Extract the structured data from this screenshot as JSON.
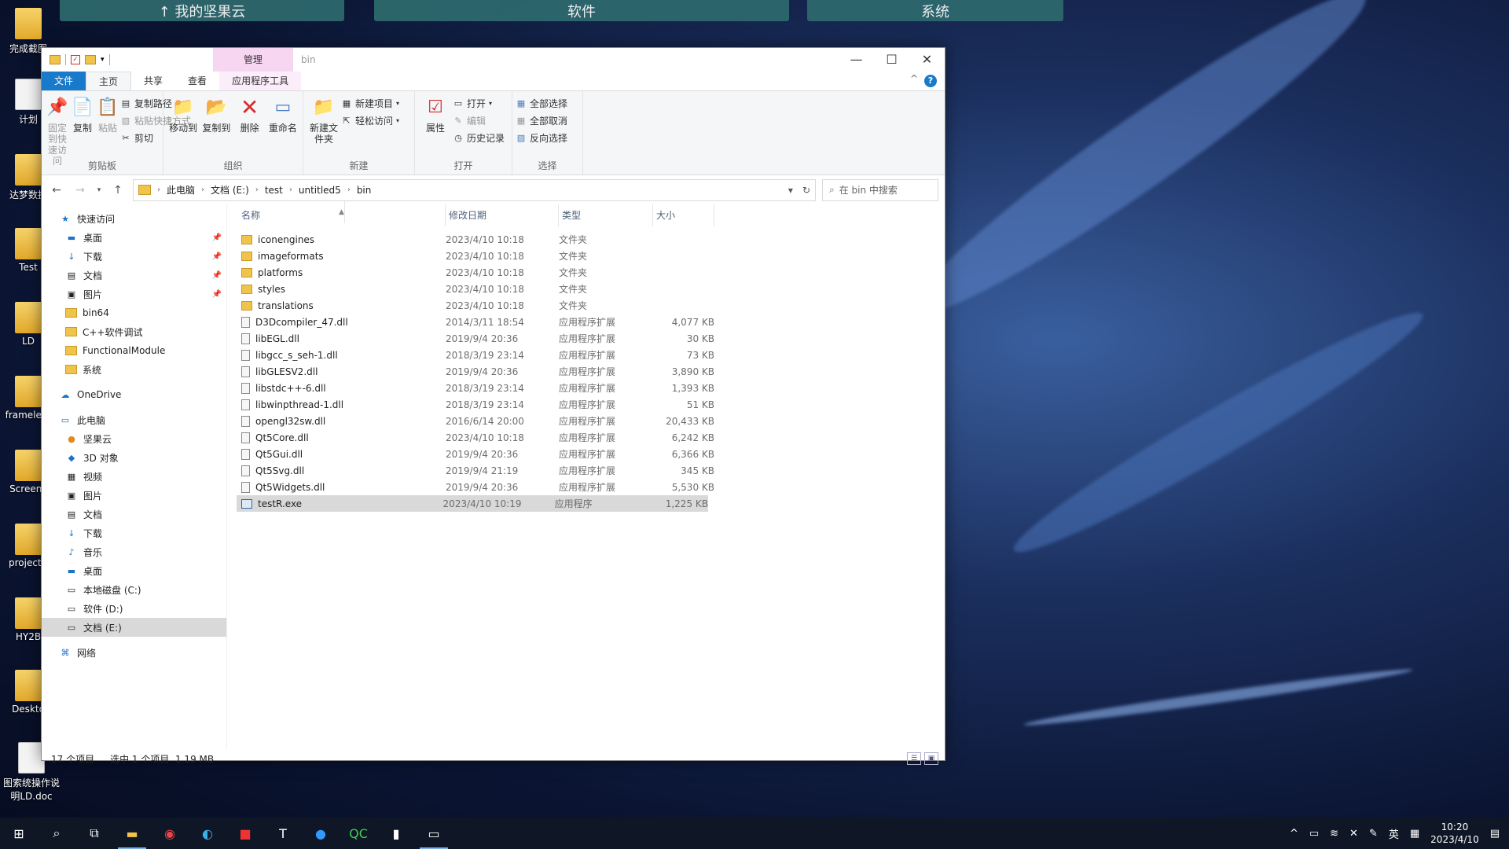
{
  "desktop": {
    "top_bar": [
      "↑ 我的坚果云",
      "软件",
      "系统"
    ],
    "icons": [
      "完成截图",
      "计划",
      "达梦数据",
      "Test",
      "LD",
      "frameless",
      "Screenc",
      "projectC",
      "HY2B",
      "Deskto",
      "图索统操作说明LD.doc"
    ]
  },
  "window": {
    "title": "bin",
    "context_tab": "管理",
    "tabs": {
      "file": "文件",
      "home": "主页",
      "share": "共享",
      "view": "查看",
      "app_tools": "应用程序工具"
    },
    "ribbon": {
      "clipboard": {
        "pin": "固定到快速访问",
        "copy": "复制",
        "paste": "粘贴",
        "copy_path": "复制路径",
        "paste_shortcut": "粘贴快捷方式",
        "cut": "剪切",
        "label": "剪贴板"
      },
      "organize": {
        "move_to": "移动到",
        "copy_to": "复制到",
        "delete": "删除",
        "rename": "重命名",
        "label": "组织"
      },
      "new": {
        "new_folder": "新建文件夹",
        "new_item": "新建项目",
        "easy_access": "轻松访问",
        "label": "新建"
      },
      "open": {
        "properties": "属性",
        "open": "打开",
        "edit": "编辑",
        "history": "历史记录",
        "label": "打开"
      },
      "select": {
        "select_all": "全部选择",
        "select_none": "全部取消",
        "invert": "反向选择",
        "label": "选择"
      }
    },
    "address": {
      "crumbs": [
        "此电脑",
        "文档 (E:)",
        "test",
        "untitled5",
        "bin"
      ],
      "search_placeholder": "在 bin 中搜索"
    },
    "nav": {
      "quick_access": "快速访问",
      "quick_items": [
        "桌面",
        "下载",
        "文档",
        "图片",
        "bin64",
        "C++软件调试",
        "FunctionalModule",
        "系统"
      ],
      "onedrive": "OneDrive",
      "this_pc": "此电脑",
      "pc_items": [
        "坚果云",
        "3D 对象",
        "视频",
        "图片",
        "文档",
        "下载",
        "音乐",
        "桌面",
        "本地磁盘 (C:)",
        "软件 (D:)",
        "文档 (E:)"
      ],
      "network": "网络"
    },
    "columns": {
      "name": "名称",
      "date": "修改日期",
      "type": "类型",
      "size": "大小"
    },
    "files": [
      {
        "name": "iconengines",
        "date": "2023/4/10 10:18",
        "type": "文件夹",
        "size": "",
        "icon": "folder"
      },
      {
        "name": "imageformats",
        "date": "2023/4/10 10:18",
        "type": "文件夹",
        "size": "",
        "icon": "folder"
      },
      {
        "name": "platforms",
        "date": "2023/4/10 10:18",
        "type": "文件夹",
        "size": "",
        "icon": "folder"
      },
      {
        "name": "styles",
        "date": "2023/4/10 10:18",
        "type": "文件夹",
        "size": "",
        "icon": "folder"
      },
      {
        "name": "translations",
        "date": "2023/4/10 10:18",
        "type": "文件夹",
        "size": "",
        "icon": "folder"
      },
      {
        "name": "D3Dcompiler_47.dll",
        "date": "2014/3/11 18:54",
        "type": "应用程序扩展",
        "size": "4,077 KB",
        "icon": "dll"
      },
      {
        "name": "libEGL.dll",
        "date": "2019/9/4 20:36",
        "type": "应用程序扩展",
        "size": "30 KB",
        "icon": "dll"
      },
      {
        "name": "libgcc_s_seh-1.dll",
        "date": "2018/3/19 23:14",
        "type": "应用程序扩展",
        "size": "73 KB",
        "icon": "dll"
      },
      {
        "name": "libGLESV2.dll",
        "date": "2019/9/4 20:36",
        "type": "应用程序扩展",
        "size": "3,890 KB",
        "icon": "dll"
      },
      {
        "name": "libstdc++-6.dll",
        "date": "2018/3/19 23:14",
        "type": "应用程序扩展",
        "size": "1,393 KB",
        "icon": "dll"
      },
      {
        "name": "libwinpthread-1.dll",
        "date": "2018/3/19 23:14",
        "type": "应用程序扩展",
        "size": "51 KB",
        "icon": "dll"
      },
      {
        "name": "opengl32sw.dll",
        "date": "2016/6/14 20:00",
        "type": "应用程序扩展",
        "size": "20,433 KB",
        "icon": "dll"
      },
      {
        "name": "Qt5Core.dll",
        "date": "2023/4/10 10:18",
        "type": "应用程序扩展",
        "size": "6,242 KB",
        "icon": "dll"
      },
      {
        "name": "Qt5Gui.dll",
        "date": "2019/9/4 20:36",
        "type": "应用程序扩展",
        "size": "6,366 KB",
        "icon": "dll"
      },
      {
        "name": "Qt5Svg.dll",
        "date": "2019/9/4 21:19",
        "type": "应用程序扩展",
        "size": "345 KB",
        "icon": "dll"
      },
      {
        "name": "Qt5Widgets.dll",
        "date": "2019/9/4 20:36",
        "type": "应用程序扩展",
        "size": "5,530 KB",
        "icon": "dll"
      },
      {
        "name": "testR.exe",
        "date": "2023/4/10 10:19",
        "type": "应用程序",
        "size": "1,225 KB",
        "icon": "exe",
        "selected": true
      }
    ],
    "status": {
      "count": "17 个项目",
      "selection": "选中 1 个项目  1.19 MB"
    }
  },
  "taskbar": {
    "time": "10:20",
    "date": "2023/4/10",
    "ime": "英"
  }
}
